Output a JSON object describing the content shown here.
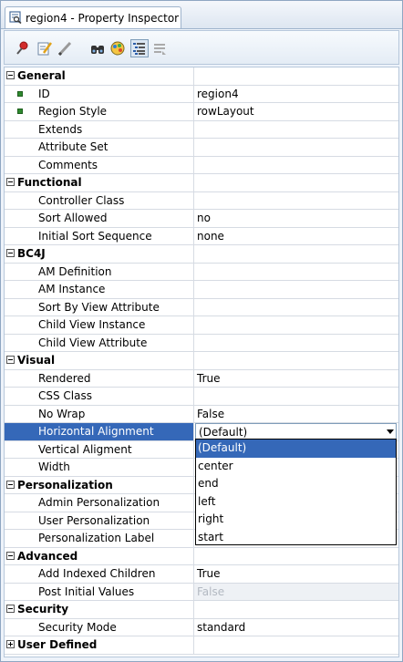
{
  "window": {
    "tab_title": "region4 - Property Inspector"
  },
  "toolbar": {
    "buttons": [
      {
        "icon": "pin-icon"
      },
      {
        "icon": "edit-icon"
      },
      {
        "icon": "pencil-icon"
      },
      {
        "icon": "binoculars-icon"
      },
      {
        "icon": "palette-icon"
      },
      {
        "icon": "categorized-view-icon",
        "active": true
      },
      {
        "icon": "alphabetical-view-icon"
      }
    ]
  },
  "grid": {
    "categories": {
      "general": "General",
      "functional": "Functional",
      "bc4j": "BC4J",
      "visual": "Visual",
      "personalization": "Personalization",
      "advanced": "Advanced",
      "security": "Security",
      "user_defined": "User Defined"
    },
    "props": {
      "id": {
        "name": "ID",
        "value": "region4"
      },
      "region_style": {
        "name": "Region Style",
        "value": "rowLayout"
      },
      "extends": {
        "name": "Extends",
        "value": ""
      },
      "attribute_set": {
        "name": "Attribute Set",
        "value": ""
      },
      "comments": {
        "name": "Comments",
        "value": ""
      },
      "controller_class": {
        "name": "Controller Class",
        "value": ""
      },
      "sort_allowed": {
        "name": "Sort Allowed",
        "value": "no"
      },
      "initial_sort_sequence": {
        "name": "Initial Sort Sequence",
        "value": "none"
      },
      "am_definition": {
        "name": "AM Definition",
        "value": ""
      },
      "am_instance": {
        "name": "AM Instance",
        "value": ""
      },
      "sort_by_view_attribute": {
        "name": "Sort By View Attribute",
        "value": ""
      },
      "child_view_instance": {
        "name": "Child View Instance",
        "value": ""
      },
      "child_view_attribute": {
        "name": "Child View Attribute",
        "value": ""
      },
      "rendered": {
        "name": "Rendered",
        "value": "True"
      },
      "css_class": {
        "name": "CSS Class",
        "value": ""
      },
      "no_wrap": {
        "name": "No Wrap",
        "value": "False"
      },
      "horizontal_alignment": {
        "name": "Horizontal Alignment",
        "value": "(Default)"
      },
      "vertical_alignment": {
        "name": "Vertical Aligment",
        "value": ""
      },
      "width": {
        "name": "Width",
        "value": ""
      },
      "admin_personalization": {
        "name": "Admin Personalization",
        "value": ""
      },
      "user_personalization": {
        "name": "User Personalization",
        "value": ""
      },
      "personalization_label": {
        "name": "Personalization Label",
        "value": ""
      },
      "add_indexed_children": {
        "name": "Add Indexed Children",
        "value": "True"
      },
      "post_initial_values": {
        "name": "Post Initial Values",
        "value": "False"
      },
      "security_mode": {
        "name": "Security Mode",
        "value": "standard"
      }
    }
  },
  "dropdown": {
    "options": [
      "(Default)",
      "center",
      "end",
      "left",
      "right",
      "start"
    ],
    "selected": "(Default)"
  },
  "colors": {
    "selection": "#3568b8",
    "required_marker": "#2f8a2f"
  }
}
